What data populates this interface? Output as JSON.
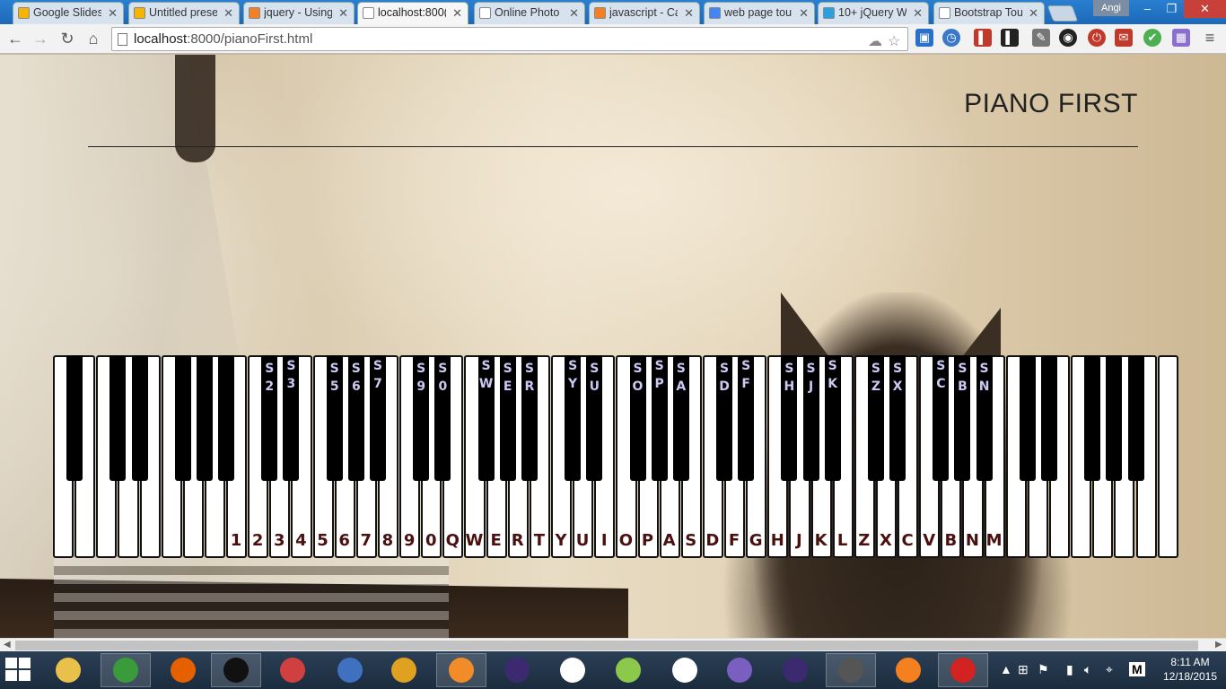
{
  "browser": {
    "tabs": [
      {
        "label": "Google Slides",
        "icon": "slides-icon",
        "color": "#f4b400"
      },
      {
        "label": "Untitled prese",
        "icon": "slides-icon",
        "color": "#f4b400"
      },
      {
        "label": "jquery - Using",
        "icon": "stackoverflow-icon",
        "color": "#f48024"
      },
      {
        "label": "localhost:800(",
        "icon": "page-icon",
        "color": "#ffffff",
        "active": true
      },
      {
        "label": "Online Photo",
        "icon": "page-icon",
        "color": "#ffffff"
      },
      {
        "label": "javascript - Ca",
        "icon": "stackoverflow-icon",
        "color": "#f48024"
      },
      {
        "label": "web page tou",
        "icon": "google-icon",
        "color": "#4285f4"
      },
      {
        "label": "10+ jQuery W",
        "icon": "site-icon",
        "color": "#2aa0e0"
      },
      {
        "label": "Bootstrap Tou",
        "icon": "page-icon",
        "color": "#ffffff"
      }
    ],
    "user": "Angi",
    "url_host": "localhost",
    "url_rest": ":8000/pianoFirst.html",
    "back": "←",
    "forward": "→",
    "reload": "↻",
    "home": "⌂",
    "star": "☆",
    "menu": "≡"
  },
  "page": {
    "title": "PIANO FIRST"
  },
  "keyboard": {
    "white_labels": [
      "1",
      "2",
      "3",
      "4",
      "5",
      "6",
      "7",
      "8",
      "9",
      "0",
      "Q",
      "W",
      "E",
      "R",
      "T",
      "Y",
      "U",
      "I",
      "O",
      "P",
      "A",
      "S",
      "D",
      "F",
      "G",
      "H",
      "J",
      "K",
      "L",
      "Z",
      "X",
      "C",
      "V",
      "B",
      "N",
      "M"
    ],
    "black_labels": [
      {
        "top": "S",
        "bottom": "2"
      },
      {
        "top": "S",
        "bottom": "3"
      },
      {
        "top": "S",
        "bottom": "5"
      },
      {
        "top": "S",
        "bottom": "6"
      },
      {
        "top": "S",
        "bottom": "7"
      },
      {
        "top": "S",
        "bottom": "9"
      },
      {
        "top": "S",
        "bottom": "0"
      },
      {
        "top": "S",
        "bottom": "W"
      },
      {
        "top": "S",
        "bottom": "E"
      },
      {
        "top": "S",
        "bottom": "R"
      },
      {
        "top": "S",
        "bottom": "Y"
      },
      {
        "top": "S",
        "bottom": "U"
      },
      {
        "top": "S",
        "bottom": "O"
      },
      {
        "top": "S",
        "bottom": "P"
      },
      {
        "top": "S",
        "bottom": "A"
      },
      {
        "top": "S",
        "bottom": "D"
      },
      {
        "top": "S",
        "bottom": "F"
      },
      {
        "top": "S",
        "bottom": "H"
      },
      {
        "top": "S",
        "bottom": "J"
      },
      {
        "top": "S",
        "bottom": "K"
      },
      {
        "top": "S",
        "bottom": "Z"
      },
      {
        "top": "S",
        "bottom": "X"
      },
      {
        "top": "S",
        "bottom": "C"
      },
      {
        "top": "S",
        "bottom": "B"
      },
      {
        "top": "S",
        "bottom": "N"
      }
    ]
  },
  "taskbar": {
    "clock_time": "8:11 AM",
    "clock_date": "12/18/2015",
    "lang": "M",
    "apps": [
      {
        "name": "explorer-icon",
        "color": "#e8c04a"
      },
      {
        "name": "chrome-icon",
        "color": "#3a9b3a",
        "running": true
      },
      {
        "name": "firefox-icon",
        "color": "#e66000"
      },
      {
        "name": "cmd-icon",
        "color": "#111111",
        "running": true
      },
      {
        "name": "snipping-tool-icon",
        "color": "#d04040"
      },
      {
        "name": "link-icon",
        "color": "#4070c0"
      },
      {
        "name": "phpstorm-icon",
        "color": "#e0a020"
      },
      {
        "name": "pdf-icon",
        "color": "#f28c28",
        "running": true
      },
      {
        "name": "eclipse-icon",
        "color": "#3b2a70"
      },
      {
        "name": "inkscape-icon",
        "color": "#ffffff"
      },
      {
        "name": "folder-icon",
        "color": "#8cc84b"
      },
      {
        "name": "apps-icon",
        "color": "#ffffff"
      },
      {
        "name": "github-icon",
        "color": "#7a5fc0"
      },
      {
        "name": "eclipse-icon-2",
        "color": "#3b2a70"
      },
      {
        "name": "sublime-icon",
        "color": "#555555",
        "running": true
      },
      {
        "name": "blender-icon",
        "color": "#f58020"
      },
      {
        "name": "netease-icon",
        "color": "#d22222",
        "running": true
      }
    ]
  }
}
